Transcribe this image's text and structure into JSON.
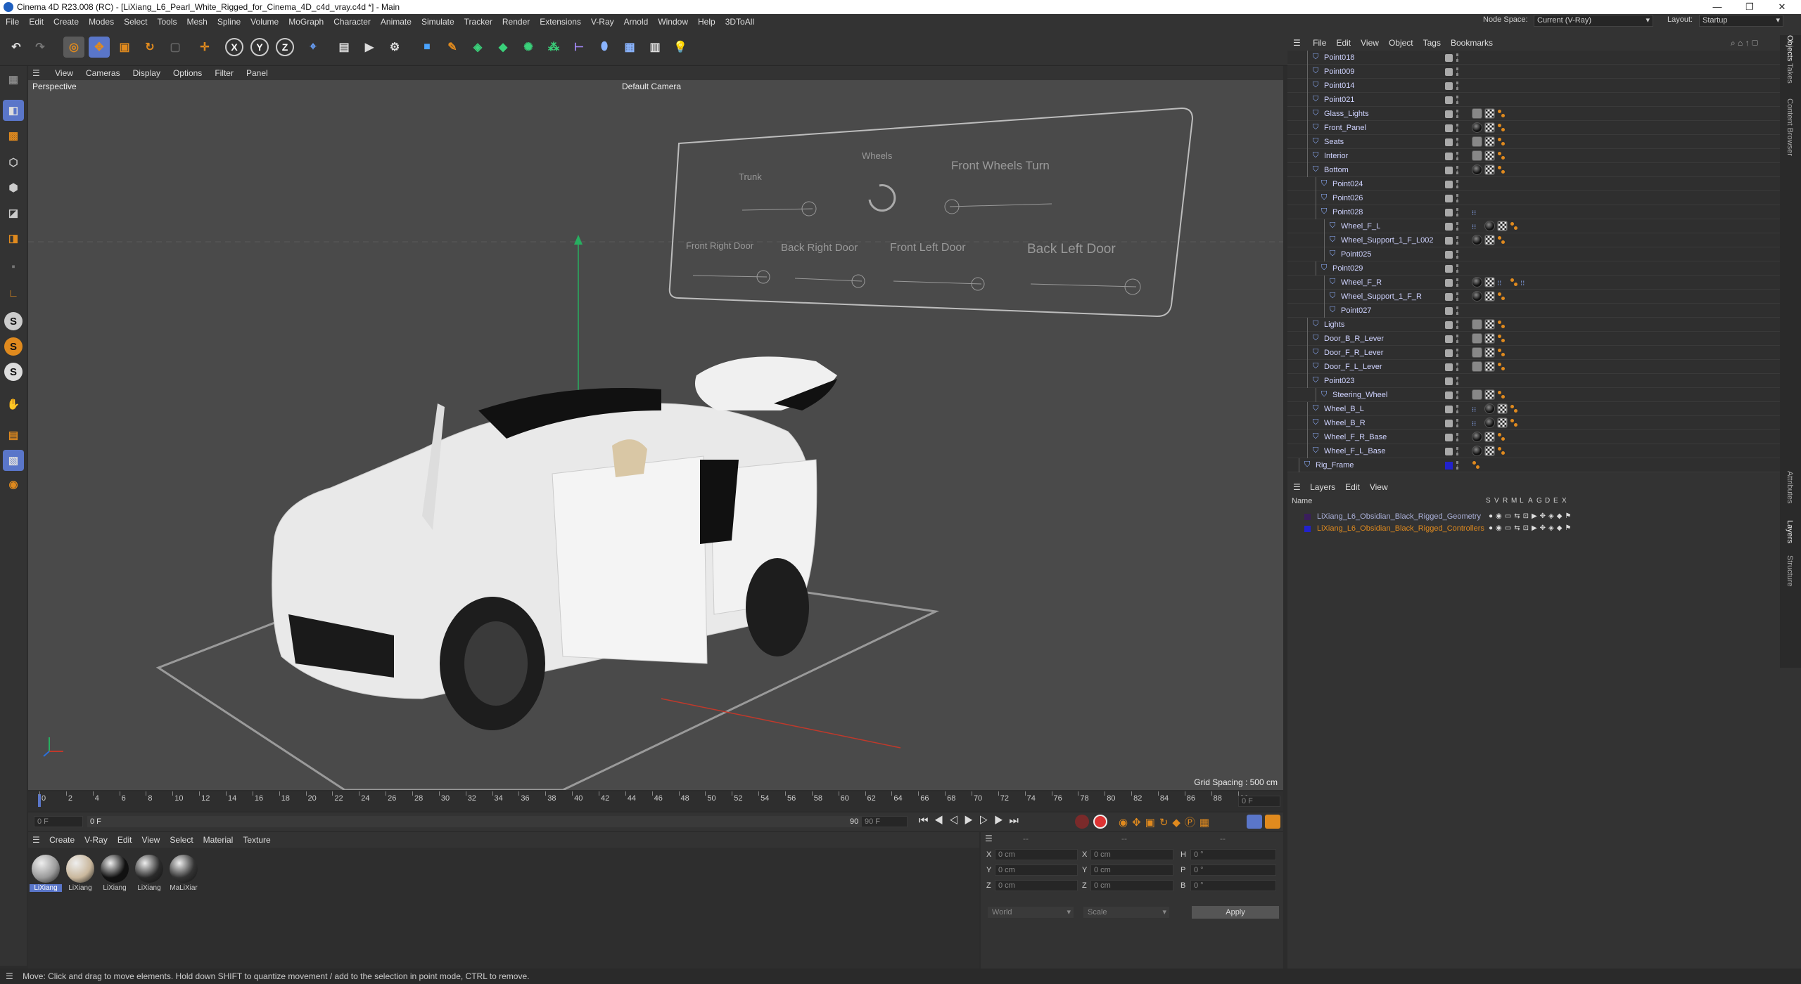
{
  "window": {
    "title": "Cinema 4D R23.008 (RC) - [LiXiang_L6_Pearl_White_Rigged_for_Cinema_4D_c4d_vray.c4d *] - Main"
  },
  "menu": [
    "File",
    "Edit",
    "Create",
    "Modes",
    "Select",
    "Tools",
    "Mesh",
    "Spline",
    "Volume",
    "MoGraph",
    "Character",
    "Animate",
    "Simulate",
    "Tracker",
    "Render",
    "Extensions",
    "V-Ray",
    "Arnold",
    "Window",
    "Help",
    "3DToAll"
  ],
  "node_space": {
    "label": "Node Space:",
    "value": "Current (V-Ray)"
  },
  "layout": {
    "label": "Layout:",
    "value": "Startup"
  },
  "viewport": {
    "menu": [
      "View",
      "Cameras",
      "Display",
      "Options",
      "Filter",
      "Panel"
    ],
    "projection": "Perspective",
    "camera": "Default Camera",
    "grid_spacing": "Grid Spacing : 500 cm",
    "rig_labels": [
      "Trunk",
      "Wheels",
      "Front Wheels Turn",
      "Front Right Door",
      "Back Right Door",
      "Front Left Door",
      "Back Left Door"
    ]
  },
  "timeline": {
    "ticks": [
      "0",
      "2",
      "4",
      "6",
      "8",
      "10",
      "12",
      "14",
      "16",
      "18",
      "20",
      "22",
      "24",
      "26",
      "28",
      "30",
      "32",
      "34",
      "36",
      "38",
      "40",
      "42",
      "44",
      "46",
      "48",
      "50",
      "52",
      "54",
      "56",
      "58",
      "60",
      "62",
      "64",
      "66",
      "68",
      "70",
      "72",
      "74",
      "76",
      "78",
      "80",
      "82",
      "84",
      "86",
      "88",
      "90"
    ],
    "frame_field": "0 F",
    "current": "0 F",
    "start": "0 F",
    "end": "90 F",
    "end2": "90 F"
  },
  "materials": {
    "menu": [
      "Create",
      "V-Ray",
      "Edit",
      "View",
      "Select",
      "Material",
      "Texture"
    ],
    "items": [
      "LiXiang",
      "LiXiang",
      "LiXiang",
      "LiXiang",
      "MaLiXiar"
    ]
  },
  "attributes": {
    "coords": [
      "X",
      "Y",
      "Z"
    ],
    "pos": [
      "0 cm",
      "0 cm",
      "0 cm"
    ],
    "size": [
      "0 cm",
      "0 cm",
      "0 cm"
    ],
    "rot_labels": [
      "H",
      "P",
      "B"
    ],
    "rot": [
      "0 °",
      "0 °",
      "0 °"
    ],
    "mode": "World",
    "scale": "Scale",
    "apply": "Apply",
    "dashes": [
      "--",
      "--",
      "--"
    ]
  },
  "objects": {
    "menu": [
      "File",
      "Edit",
      "View",
      "Object",
      "Tags",
      "Bookmarks"
    ],
    "rows": [
      {
        "name": "Point018",
        "indent": 2,
        "tags": []
      },
      {
        "name": "Point009",
        "indent": 2,
        "tags": []
      },
      {
        "name": "Point014",
        "indent": 2,
        "tags": []
      },
      {
        "name": "Point021",
        "indent": 2,
        "tags": []
      },
      {
        "name": "Glass_Lights",
        "indent": 2,
        "tags": [
          "phong",
          "checker",
          "orange"
        ]
      },
      {
        "name": "Front_Panel",
        "indent": 2,
        "tags": [
          "dark",
          "checker",
          "orange"
        ]
      },
      {
        "name": "Seats",
        "indent": 2,
        "tags": [
          "phong",
          "checker",
          "orange"
        ]
      },
      {
        "name": "Interior",
        "indent": 2,
        "tags": [
          "phong",
          "checker",
          "orange"
        ]
      },
      {
        "name": "Bottom",
        "indent": 2,
        "tags": [
          "dark",
          "checker",
          "orange"
        ]
      },
      {
        "name": "Point024",
        "indent": 3,
        "tags": []
      },
      {
        "name": "Point026",
        "indent": 3,
        "tags": []
      },
      {
        "name": "Point028",
        "indent": 3,
        "tags": [
          "dots"
        ]
      },
      {
        "name": "Wheel_F_L",
        "indent": 4,
        "tags": [
          "dots",
          "dark",
          "checker",
          "orange"
        ]
      },
      {
        "name": "Wheel_Support_1_F_L002",
        "indent": 4,
        "tags": [
          "dark",
          "checker",
          "orange"
        ]
      },
      {
        "name": "Point025",
        "indent": 4,
        "tags": []
      },
      {
        "name": "Point029",
        "indent": 3,
        "tags": []
      },
      {
        "name": "Wheel_F_R",
        "indent": 4,
        "tags": [
          "dark",
          "checker",
          "dots",
          "orange",
          "dots"
        ]
      },
      {
        "name": "Wheel_Support_1_F_R",
        "indent": 4,
        "tags": [
          "dark",
          "checker",
          "orange"
        ]
      },
      {
        "name": "Point027",
        "indent": 4,
        "tags": []
      },
      {
        "name": "Lights",
        "indent": 2,
        "tags": [
          "phong",
          "checker",
          "orange"
        ]
      },
      {
        "name": "Door_B_R_Lever",
        "indent": 2,
        "tags": [
          "phong",
          "checker",
          "orange"
        ]
      },
      {
        "name": "Door_F_R_Lever",
        "indent": 2,
        "tags": [
          "phong",
          "checker",
          "orange"
        ]
      },
      {
        "name": "Door_F_L_Lever",
        "indent": 2,
        "tags": [
          "phong",
          "checker",
          "orange"
        ]
      },
      {
        "name": "Point023",
        "indent": 2,
        "tags": []
      },
      {
        "name": "Steering_Wheel",
        "indent": 3,
        "tags": [
          "phong",
          "checker",
          "orange"
        ]
      },
      {
        "name": "Wheel_B_L",
        "indent": 2,
        "tags": [
          "dots",
          "dark",
          "checker",
          "orange"
        ]
      },
      {
        "name": "Wheel_B_R",
        "indent": 2,
        "tags": [
          "dots",
          "dark",
          "checker",
          "orange"
        ]
      },
      {
        "name": "Wheel_F_R_Base",
        "indent": 2,
        "tags": [
          "dark",
          "checker",
          "orange"
        ]
      },
      {
        "name": "Wheel_F_L_Base",
        "indent": 2,
        "tags": [
          "dark",
          "checker",
          "orange"
        ]
      },
      {
        "name": "Rig_Frame",
        "indent": 1,
        "tags": [
          "orange"
        ]
      }
    ]
  },
  "layers": {
    "menu": [
      "Layers",
      "Edit",
      "View"
    ],
    "col_name": "Name",
    "cols": [
      "S",
      "V",
      "R",
      "M",
      "L",
      "A",
      "G",
      "D",
      "E",
      "X"
    ],
    "items": [
      {
        "name": "LiXiang_L6_Obsidian_Black_Rigged_Geometry",
        "color": "#3a1e5c"
      },
      {
        "name": "LiXiang_L6_Obsidian_Black_Rigged_Controllers",
        "color": "#2222cc"
      }
    ]
  },
  "side_tabs": [
    "Objects",
    "Takes",
    "Content Browser",
    "Attributes",
    "Layers",
    "Structure"
  ],
  "status": "Move: Click and drag to move elements. Hold down SHIFT to quantize movement / add to the selection in point mode, CTRL to remove.",
  "colors": {
    "accent": "#e08a1e",
    "selection": "#5a76c9"
  }
}
